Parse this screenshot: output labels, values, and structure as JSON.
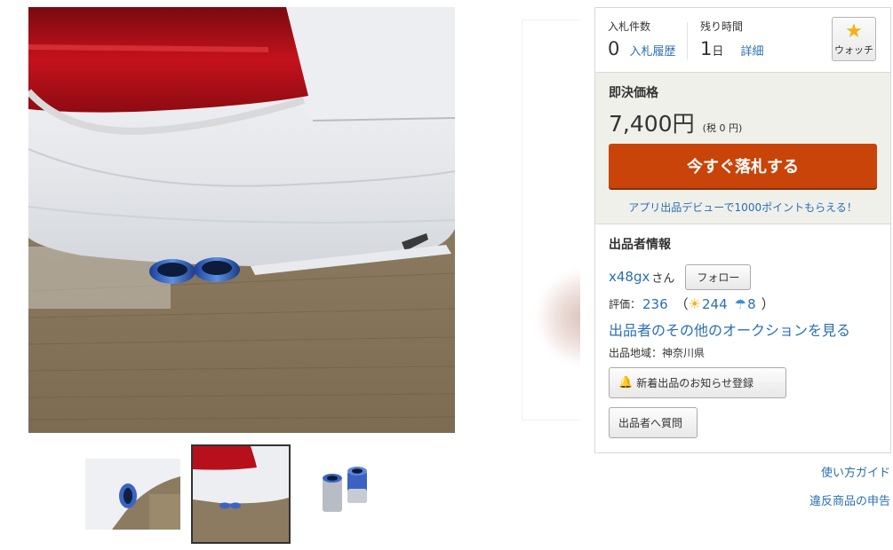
{
  "bid": {
    "count_label": "入札件数",
    "count_value": "0",
    "history_link": "入札履歴",
    "time_label": "残り時間",
    "time_value": "1",
    "time_unit": "日",
    "detail_link": "詳細"
  },
  "watch": {
    "label": "ウォッチ",
    "icon": "star-icon"
  },
  "buy_now": {
    "title": "即決価格",
    "price": "7,400円",
    "tax": "(税 0 円)",
    "button_label": "今すぐ落札する",
    "promo_text": "アプリ出品デビューで1000ポイントもらえる！"
  },
  "seller": {
    "section_title": "出品者情報",
    "name": "x48gx",
    "honorific": "さん",
    "follow_label": "フォロー",
    "rating_label": "評価：",
    "rating_total": "236",
    "rating_open": "（",
    "good_count": "244",
    "bad_count": "8",
    "rating_close": "）",
    "other_auctions_link": "出品者のその他のオークションを見る",
    "region": "出品地域：神奈川県",
    "notify_button": "新着出品のお知らせ登録",
    "question_button": "出品者へ質問"
  },
  "links": {
    "guide": "使い方ガイド",
    "report": "違反商品の申告"
  },
  "colors": {
    "buy_button": "#c94409",
    "link": "#2a6fb3",
    "buy_box_bg": "#f0f0eb",
    "watch_star": "#f2b315"
  }
}
